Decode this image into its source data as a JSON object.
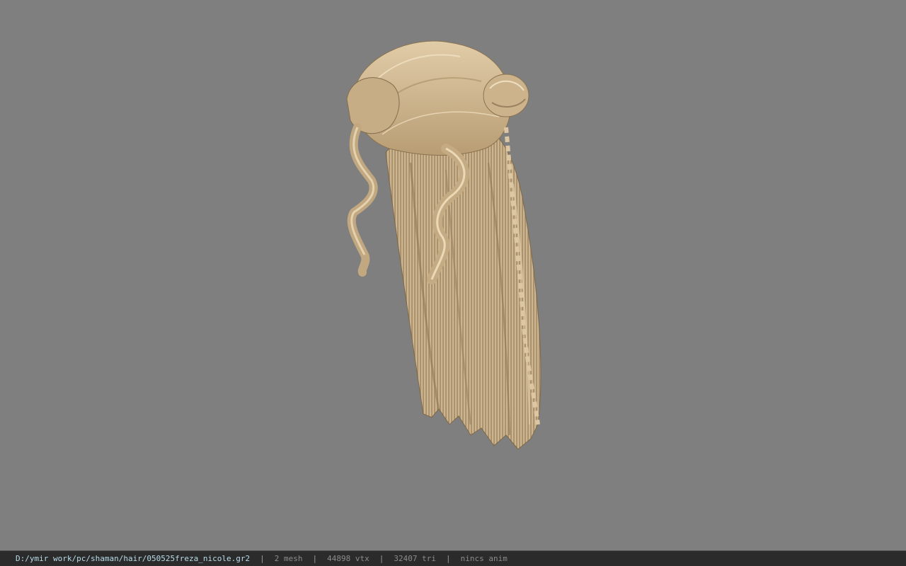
{
  "viewport": {
    "background": "#7f7f7f",
    "model_name": "hair-mesh"
  },
  "statusbar": {
    "file_path": "D:/ymir work/pc/shaman/hair/050525freza_nicole.gr2",
    "separator": "|",
    "mesh_count": "2 mesh",
    "vertex_count": "44898 vtx",
    "triangle_count": "32407 tri",
    "anim_status": "nincs anim",
    "colors": {
      "background": "#2b2b2b",
      "path": "#b8dcea",
      "stats": "#8c8c8c"
    }
  }
}
